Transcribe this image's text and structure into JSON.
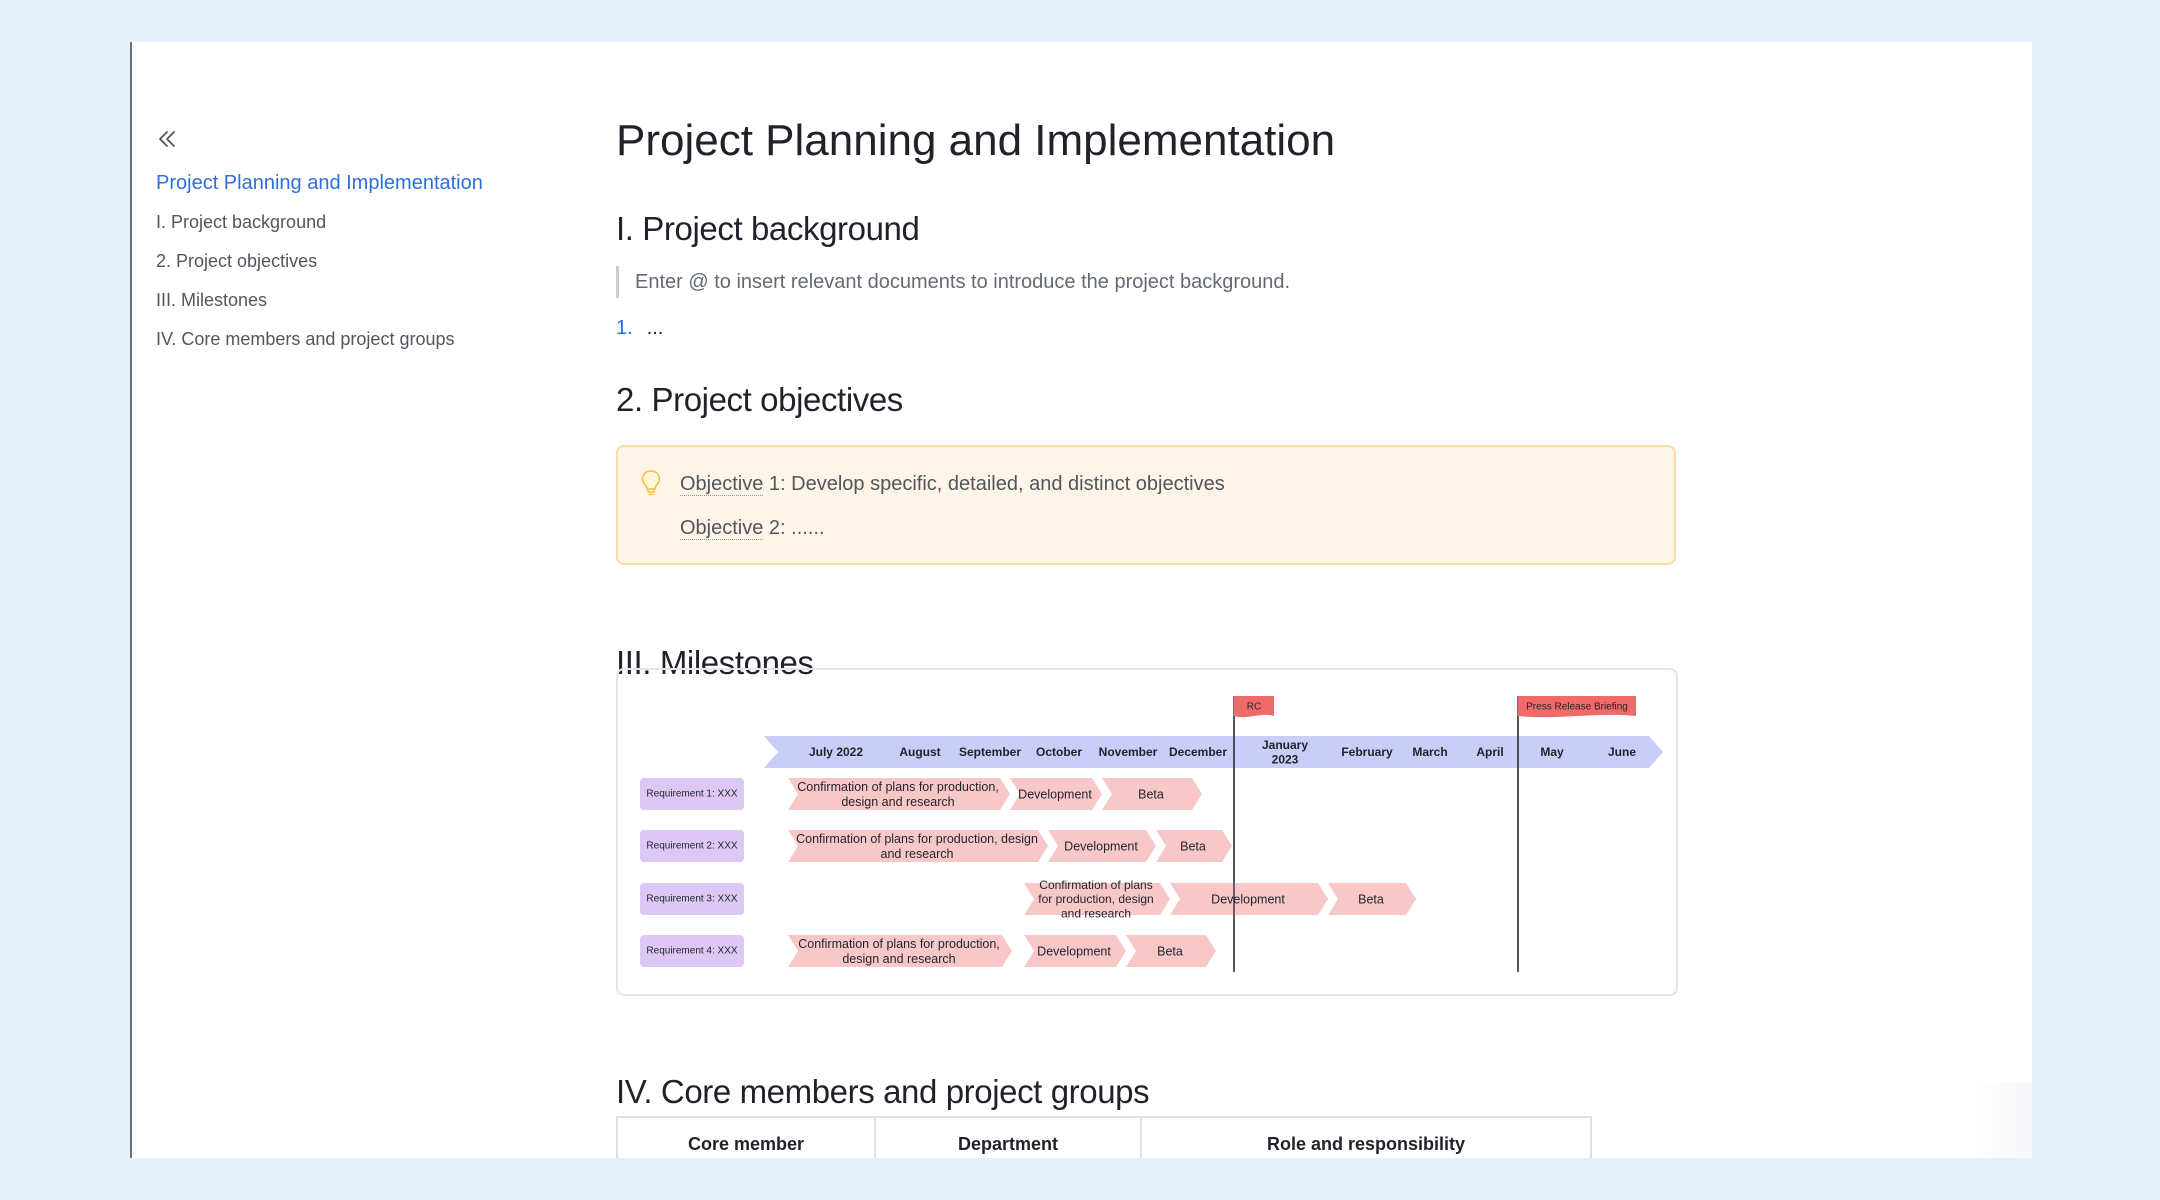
{
  "toc": {
    "items": [
      {
        "label": "Project Planning and Implementation",
        "active": true
      },
      {
        "label": "I. Project background",
        "active": false
      },
      {
        "label": "2. Project objectives",
        "active": false
      },
      {
        "label": "III. Milestones",
        "active": false
      },
      {
        "label": "IV. Core members and project groups",
        "active": false
      }
    ]
  },
  "doc": {
    "title": "Project Planning and Implementation",
    "sections": {
      "background": {
        "heading": "I. Project background",
        "quote": "Enter @ to insert relevant documents to introduce the project background.",
        "list_num": "1.",
        "list_text": "..."
      },
      "objectives": {
        "heading": "2. Project objectives",
        "line1_link": "Objective",
        "line1_rest": " 1: Develop specific, detailed, and distinct objectives",
        "line2_link": "Objective",
        "line2_rest": " 2: ......"
      },
      "milestones": {
        "heading": "III. Milestones"
      },
      "members": {
        "heading": "IV. Core members and project groups"
      }
    }
  },
  "milestones_chart": {
    "months": [
      "July 2022",
      "August",
      "September",
      "October",
      "November",
      "December",
      "January 2023",
      "February",
      "March",
      "April",
      "May",
      "June"
    ],
    "flags": [
      {
        "label": "RC",
        "after": "December"
      },
      {
        "label": "Press Release Briefing",
        "after": "April"
      }
    ],
    "rows": [
      {
        "label": "Requirement 1: XXX",
        "tasks": [
          {
            "text": "Confirmation of plans for production, design and research",
            "lines": [
              "Confirmation of plans for production,",
              "design and research"
            ]
          },
          {
            "text": "Development",
            "lines": [
              "Development"
            ]
          },
          {
            "text": "Beta",
            "lines": [
              "Beta"
            ]
          }
        ]
      },
      {
        "label": "Requirement 2: XXX",
        "tasks": [
          {
            "text": "Confirmation of plans for production, design and research",
            "lines": [
              "Confirmation of plans for production, design",
              "and research"
            ]
          },
          {
            "text": "Development",
            "lines": [
              "Development"
            ]
          },
          {
            "text": "Beta",
            "lines": [
              "Beta"
            ]
          }
        ]
      },
      {
        "label": "Requirement 3: XXX",
        "tasks": [
          {
            "text": "Confirmation of plans for production, design and research",
            "lines": [
              "Confirmation of plans",
              "for production, design",
              "and research"
            ]
          },
          {
            "text": "Development",
            "lines": [
              "Development"
            ]
          },
          {
            "text": "Beta",
            "lines": [
              "Beta"
            ]
          }
        ]
      },
      {
        "label": "Requirement 4: XXX",
        "tasks": [
          {
            "text": "Confirmation of plans for production, design and research",
            "lines": [
              "Confirmation of plans for production,",
              "design and research"
            ]
          },
          {
            "text": "Development",
            "lines": [
              "Development"
            ]
          },
          {
            "text": "Beta",
            "lines": [
              "Beta"
            ]
          }
        ]
      }
    ],
    "colors": {
      "timeline": "#c9cdf7",
      "requirement": "#dcc7f5",
      "task": "#f8c8c8",
      "flag": "#f06a6a"
    }
  },
  "table": {
    "headers": [
      "Core member",
      "Department",
      "Role and responsibility"
    ]
  },
  "colors": {
    "accent": "#2c6fe0",
    "background": "#e8effd",
    "callout_bg": "#fef4e8",
    "callout_border": "#fcd9a8"
  }
}
